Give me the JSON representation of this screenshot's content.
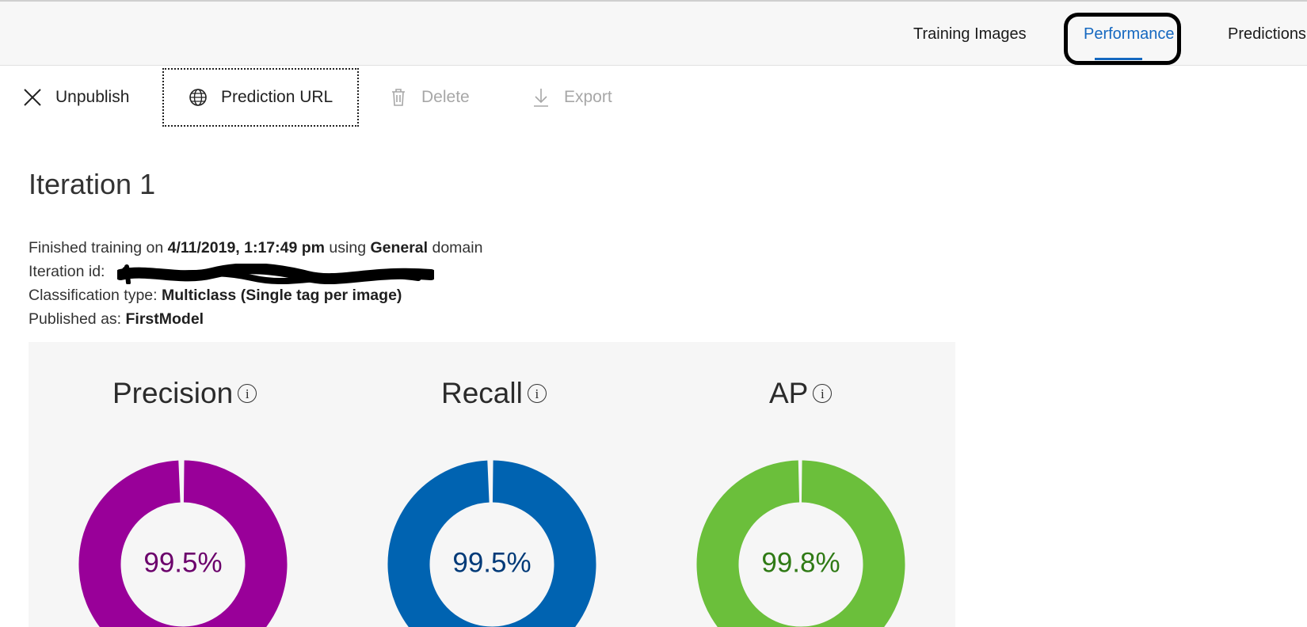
{
  "tabs": [
    {
      "label": "Training Images",
      "active": false
    },
    {
      "label": "Performance",
      "active": true
    },
    {
      "label": "Predictions",
      "active": false
    }
  ],
  "toolbar": {
    "unpublish": "Unpublish",
    "prediction_url": "Prediction URL",
    "delete": "Delete",
    "export": "Export"
  },
  "iteration": {
    "title": "Iteration 1",
    "finished_prefix": "Finished training on ",
    "finished_date": "4/11/2019, 1:17:49 pm",
    "finished_mid": " using ",
    "domain": "General",
    "finished_suffix": " domain",
    "id_label": "Iteration id: ",
    "classification_label": "Classification type: ",
    "classification_value": "Multiclass (Single tag per image)",
    "published_label": "Published as: ",
    "published_value": "FirstModel"
  },
  "metrics": [
    {
      "name": "Precision",
      "value_text": "99.5%",
      "value": 0.995,
      "color": "#990099",
      "text_color": "#6b006b"
    },
    {
      "name": "Recall",
      "value_text": "99.5%",
      "value": 0.995,
      "color": "#0063b1",
      "text_color": "#003a78"
    },
    {
      "name": "AP",
      "value_text": "99.8%",
      "value": 0.998,
      "color": "#6bbf3b",
      "text_color": "#2f7a15"
    }
  ],
  "info_glyph": "i",
  "colors": {
    "accent": "#1568c0",
    "panel": "#f6f6f6"
  }
}
